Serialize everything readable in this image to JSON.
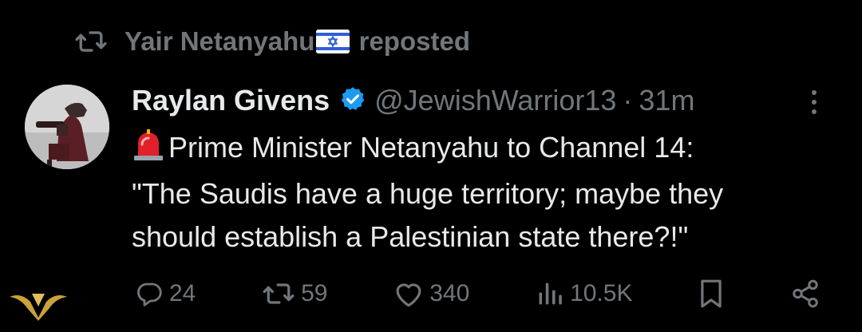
{
  "repost": {
    "reposter_name": "Yair Netanyahu",
    "reposter_flag": "israel-flag-icon",
    "label": "reposted"
  },
  "tweet": {
    "author_name": "Raylan Givens",
    "verified": true,
    "handle": "@JewishWarrior13",
    "separator": "·",
    "time": "31m",
    "text_lines": [
      "Prime Minister Netanyahu to Channel 14:",
      "\"The Saudis have a huge territory; maybe they",
      "should establish a Palestinian state there?!\""
    ],
    "lead_emoji": "rotating-light-icon"
  },
  "actions": {
    "replies": "24",
    "reposts": "59",
    "likes": "340",
    "views": "10.5K"
  },
  "colors": {
    "background": "#000000",
    "primary_text": "#e7e9ea",
    "secondary_text": "#71767b",
    "verified_blue": "#1d9bf0"
  }
}
